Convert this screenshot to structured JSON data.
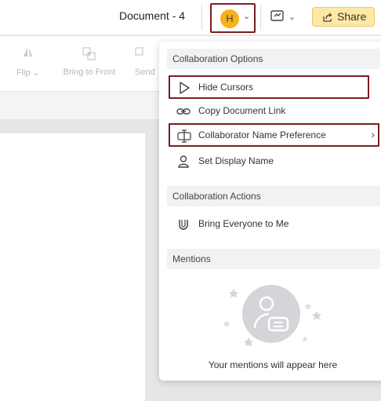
{
  "header": {
    "document_title": "Document - 4",
    "avatar_initial": "H",
    "share_label": "Share"
  },
  "toolbar": {
    "tools": [
      {
        "label": "Flip",
        "has_dropdown": true
      },
      {
        "label": "Bring to Front",
        "has_dropdown": false
      },
      {
        "label": "Send",
        "has_dropdown": false
      }
    ]
  },
  "colors": {
    "avatar_bg": "#f7b21a",
    "share_bg": "#fde9a3",
    "highlight_border": "#7a1c24"
  },
  "panel": {
    "collaboration_options": {
      "title": "Collaboration Options",
      "items": [
        {
          "label": "Hide Cursors",
          "icon": "cursor-icon"
        },
        {
          "label": "Copy Document Link",
          "icon": "link-icon"
        },
        {
          "label": "Collaborator Name Preference",
          "icon": "text-cursor-icon",
          "submenu": true
        },
        {
          "label": "Set Display Name",
          "icon": "user-icon"
        }
      ]
    },
    "collaboration_actions": {
      "title": "Collaboration Actions",
      "items": [
        {
          "label": "Bring Everyone to Me",
          "icon": "magnet-icon"
        }
      ]
    },
    "mentions": {
      "title": "Mentions",
      "empty_text": "Your mentions will appear here"
    }
  }
}
